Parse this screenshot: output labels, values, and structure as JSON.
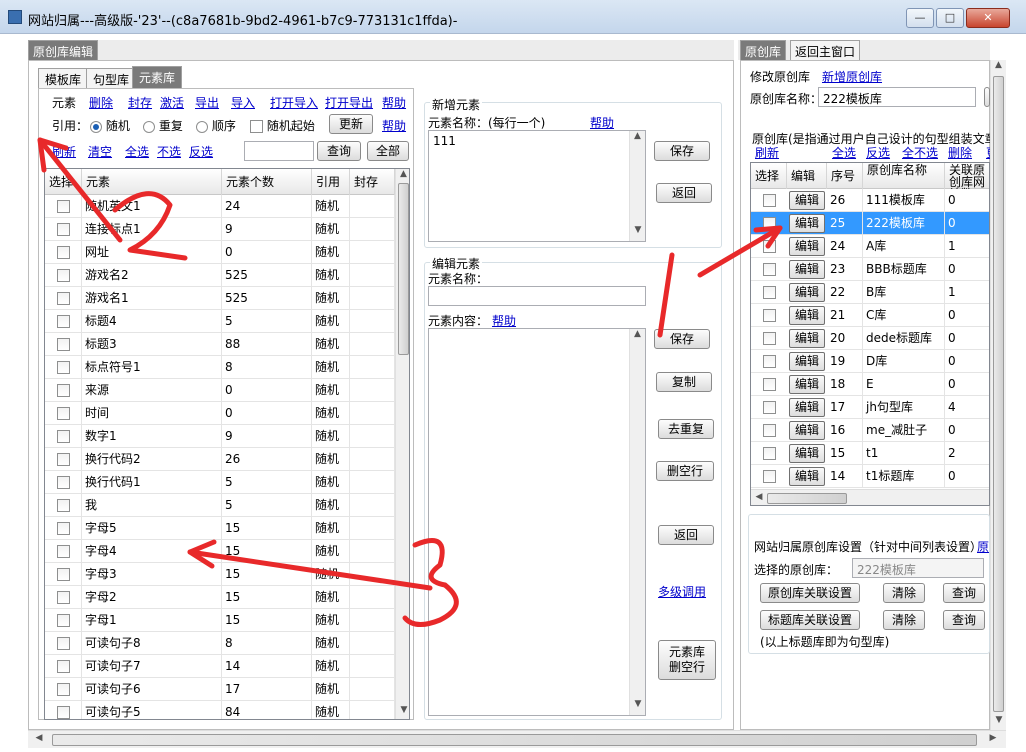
{
  "window": {
    "title": "网站归属---高级版-'23'--(c8a7681b-9bd2-4961-b7c9-773131c1ffda)-",
    "min": "—",
    "max": "□",
    "close": "✕"
  },
  "left_panel": {
    "title": "原创库编辑",
    "tabs": [
      "模板库",
      "句型库",
      "元素库"
    ],
    "toolbar1": {
      "label": "元素",
      "links": [
        "删除",
        "封存",
        "激活",
        "导出",
        "导入",
        "打开导入",
        "打开导出",
        "帮助"
      ]
    },
    "toolbar2": {
      "label": "引用：",
      "radios": [
        "随机",
        "重复",
        "顺序"
      ],
      "checkbox": "随机起始",
      "update": "更新",
      "help": "帮助"
    },
    "toolbar3": {
      "links": [
        "刷新",
        "清空",
        "全选",
        "不选",
        "反选"
      ],
      "query": "查询",
      "all": "全部"
    },
    "grid_headers": [
      "选择",
      "元素",
      "元素个数",
      "引用",
      "封存"
    ],
    "rows": [
      [
        "随机英文1",
        "24",
        "随机"
      ],
      [
        "连接标点1",
        "9",
        "随机"
      ],
      [
        "网址",
        "0",
        "随机"
      ],
      [
        "游戏名2",
        "525",
        "随机"
      ],
      [
        "游戏名1",
        "525",
        "随机"
      ],
      [
        "标题4",
        "5",
        "随机"
      ],
      [
        "标题3",
        "88",
        "随机"
      ],
      [
        "标点符号1",
        "8",
        "随机"
      ],
      [
        "来源",
        "0",
        "随机"
      ],
      [
        "时间",
        "0",
        "随机"
      ],
      [
        "数字1",
        "9",
        "随机"
      ],
      [
        "换行代码2",
        "26",
        "随机"
      ],
      [
        "换行代码1",
        "5",
        "随机"
      ],
      [
        "我",
        "5",
        "随机"
      ],
      [
        "字母5",
        "15",
        "随机"
      ],
      [
        "字母4",
        "15",
        "随机"
      ],
      [
        "字母3",
        "15",
        "随机"
      ],
      [
        "字母2",
        "15",
        "随机"
      ],
      [
        "字母1",
        "15",
        "随机"
      ],
      [
        "可读句子8",
        "8",
        "随机"
      ],
      [
        "可读句子7",
        "14",
        "随机"
      ],
      [
        "可读句子6",
        "17",
        "随机"
      ],
      [
        "可读句子5",
        "84",
        "随机"
      ]
    ]
  },
  "new_element": {
    "group_title": "新增元素",
    "name_label": "元素名称：(每行一个)",
    "help": "帮助",
    "textarea_value": "111",
    "save": "保存",
    "back": "返回"
  },
  "edit_element": {
    "group_title": "编辑元素",
    "name_label": "元素名称：",
    "content_label": "元素内容：",
    "help": "帮助",
    "buttons": [
      "保存",
      "复制",
      "去重复",
      "删空行",
      "返回"
    ],
    "multi_call": "多级调用",
    "delete_blank": "元素库\n删空行"
  },
  "right_panel": {
    "tabs": [
      "原创库",
      "返回主窗口"
    ],
    "modify_label": "修改原创库",
    "new_link": "新增原创库",
    "name_label": "原创库名称：",
    "name_value": "222模板库",
    "desc": "原创库(是指通过用户自己设计的句型组装文章",
    "links": [
      "刷新",
      "全选",
      "反选",
      "全不选",
      "删除",
      "更"
    ],
    "grid_headers": [
      "选择",
      "编辑",
      "序号",
      "原创库名称",
      "关联原创库网站数"
    ],
    "edit_label": "编辑",
    "rows": [
      [
        "26",
        "111模板库",
        "0"
      ],
      [
        "25",
        "222模板库",
        "0"
      ],
      [
        "24",
        "A库",
        "1"
      ],
      [
        "23",
        "BBB标题库",
        "0"
      ],
      [
        "22",
        "B库",
        "1"
      ],
      [
        "21",
        "C库",
        "0"
      ],
      [
        "20",
        "dede标题库",
        "0"
      ],
      [
        "19",
        "D库",
        "0"
      ],
      [
        "18",
        "E",
        "0"
      ],
      [
        "17",
        "jh句型库",
        "4"
      ],
      [
        "16",
        "me_减肚子",
        "0"
      ],
      [
        "15",
        "t1",
        "2"
      ],
      [
        "14",
        "t1标题库",
        "0"
      ]
    ],
    "selected_row_index": 1,
    "setting_title": "网站归属原创库设置（针对中间列表设置）",
    "setting_link": "原",
    "selected_label": "选择的原创库：",
    "selected_value": "222模板库",
    "buttons": {
      "assoc": "原创库关联设置",
      "clear": "清除",
      "query": "查询",
      "title_assoc": "标题库关联设置"
    },
    "note": "(以上标题库即为句型库)"
  },
  "annotations": {
    "n1": "1",
    "n2": "2",
    "n3": "3"
  },
  "colors": {
    "annotation_red": "#e8292a",
    "selected_row": "#3399ff",
    "link": "#0000cc"
  }
}
